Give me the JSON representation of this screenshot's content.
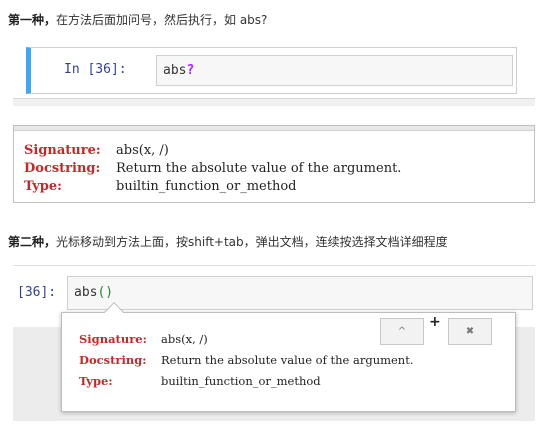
{
  "para1": {
    "bold": "第一种，",
    "text": "在方法后面加问号，然后执行，如 abs?"
  },
  "cell1": {
    "prompt": "In  [36]:",
    "code": "abs",
    "suffix": "?"
  },
  "pager1": {
    "rows": [
      {
        "key": "Signature:",
        "value": "abs(x, /)"
      },
      {
        "key": "Docstring:",
        "value": "Return the absolute value of the argument."
      },
      {
        "key": "Type:",
        "value": "builtin_function_or_method"
      }
    ]
  },
  "para2": {
    "bold": "第二种，",
    "text": "光标移动到方法上面，按shift+tab，弹出文档，连续按选择文档详细程度"
  },
  "cell2": {
    "prompt": "[36]:",
    "code": "abs",
    "paren": "()"
  },
  "tooltip": {
    "rows": [
      {
        "key": "Signature:",
        "value": "abs(x, /)"
      },
      {
        "key": "Docstring:",
        "value": "Return the absolute value of the argument."
      },
      {
        "key": "Type:",
        "value": "builtin_function_or_method"
      }
    ],
    "expand_icon": "^",
    "plus": "+",
    "close_icon": "✖"
  },
  "colors": {
    "cell_border_active": "#42a5f5",
    "prompt": "#303f9f",
    "doc_key": "#c62828",
    "paren_match": "#2e7d32"
  }
}
